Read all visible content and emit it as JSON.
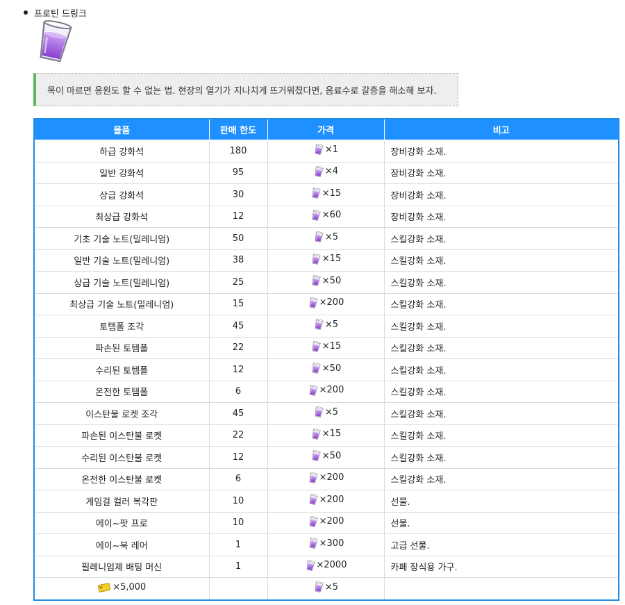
{
  "item_title": "프로틴 드링크",
  "quote": "목이 마르면 응원도 할 수 없는 법. 현장의 열기가 지나치게 뜨거워졌다면, 음료수로 갈증을 해소해 보자.",
  "table": {
    "headers": [
      "물품",
      "판매 한도",
      "가격",
      "비고"
    ],
    "rows": [
      {
        "name": "하급 강화석",
        "limit": "180",
        "price": "×1",
        "note": "장비강화 소재."
      },
      {
        "name": "일반 강화석",
        "limit": "95",
        "price": "×4",
        "note": "장비강화 소재."
      },
      {
        "name": "상급 강화석",
        "limit": "30",
        "price": "×15",
        "note": "장비강화 소재."
      },
      {
        "name": "최상급 강화석",
        "limit": "12",
        "price": "×60",
        "note": "장비강화 소재."
      },
      {
        "name": "기초 기술 노트(밀레니엄)",
        "limit": "50",
        "price": "×5",
        "note": "스킬강화 소재."
      },
      {
        "name": "일반 기술 노트(밀레니엄)",
        "limit": "38",
        "price": "×15",
        "note": "스킬강화 소재."
      },
      {
        "name": "상급 기술 노트(밀레니엄)",
        "limit": "25",
        "price": "×50",
        "note": "스킬강화 소재."
      },
      {
        "name": "최상급 기술 노트(밀레니엄)",
        "limit": "15",
        "price": "×200",
        "note": "스킬강화 소재."
      },
      {
        "name": "토템폴 조각",
        "limit": "45",
        "price": "×5",
        "note": "스킬강화 소재."
      },
      {
        "name": "파손된 토템폴",
        "limit": "22",
        "price": "×15",
        "note": "스킬강화 소재."
      },
      {
        "name": "수리된 토템폴",
        "limit": "12",
        "price": "×50",
        "note": "스킬강화 소재."
      },
      {
        "name": "온전한 토템폴",
        "limit": "6",
        "price": "×200",
        "note": "스킬강화 소재."
      },
      {
        "name": "이스탄불 로켓 조각",
        "limit": "45",
        "price": "×5",
        "note": "스킬강화 소재."
      },
      {
        "name": "파손된 이스탄불 로켓",
        "limit": "22",
        "price": "×15",
        "note": "스킬강화 소재."
      },
      {
        "name": "수리된 이스탄불 로켓",
        "limit": "12",
        "price": "×50",
        "note": "스킬강화 소재."
      },
      {
        "name": "온전한 이스탄불 로켓",
        "limit": "6",
        "price": "×200",
        "note": "스킬강화 소재."
      },
      {
        "name": "게임걸 컬러 복각판",
        "limit": "10",
        "price": "×200",
        "note": "선물."
      },
      {
        "name": "에이~팟 프로",
        "limit": "10",
        "price": "×200",
        "note": "선물."
      },
      {
        "name": "에이~북 레어",
        "limit": "1",
        "price": "×300",
        "note": "고급 선물."
      },
      {
        "name": "필레니엄제 배팅 머신",
        "limit": "1",
        "price": "×2000",
        "note": "카페 장식용 가구."
      },
      {
        "name": "×5,000",
        "name_icon": "credit-ticket-icon",
        "limit": "",
        "price": "×5",
        "note": ""
      }
    ]
  },
  "icons": {
    "currency": "protein-drink-cup-icon"
  },
  "colors": {
    "header_bg": "#1e90ff",
    "quote_bar": "#5cb85c",
    "cup": "#9b59d6"
  }
}
